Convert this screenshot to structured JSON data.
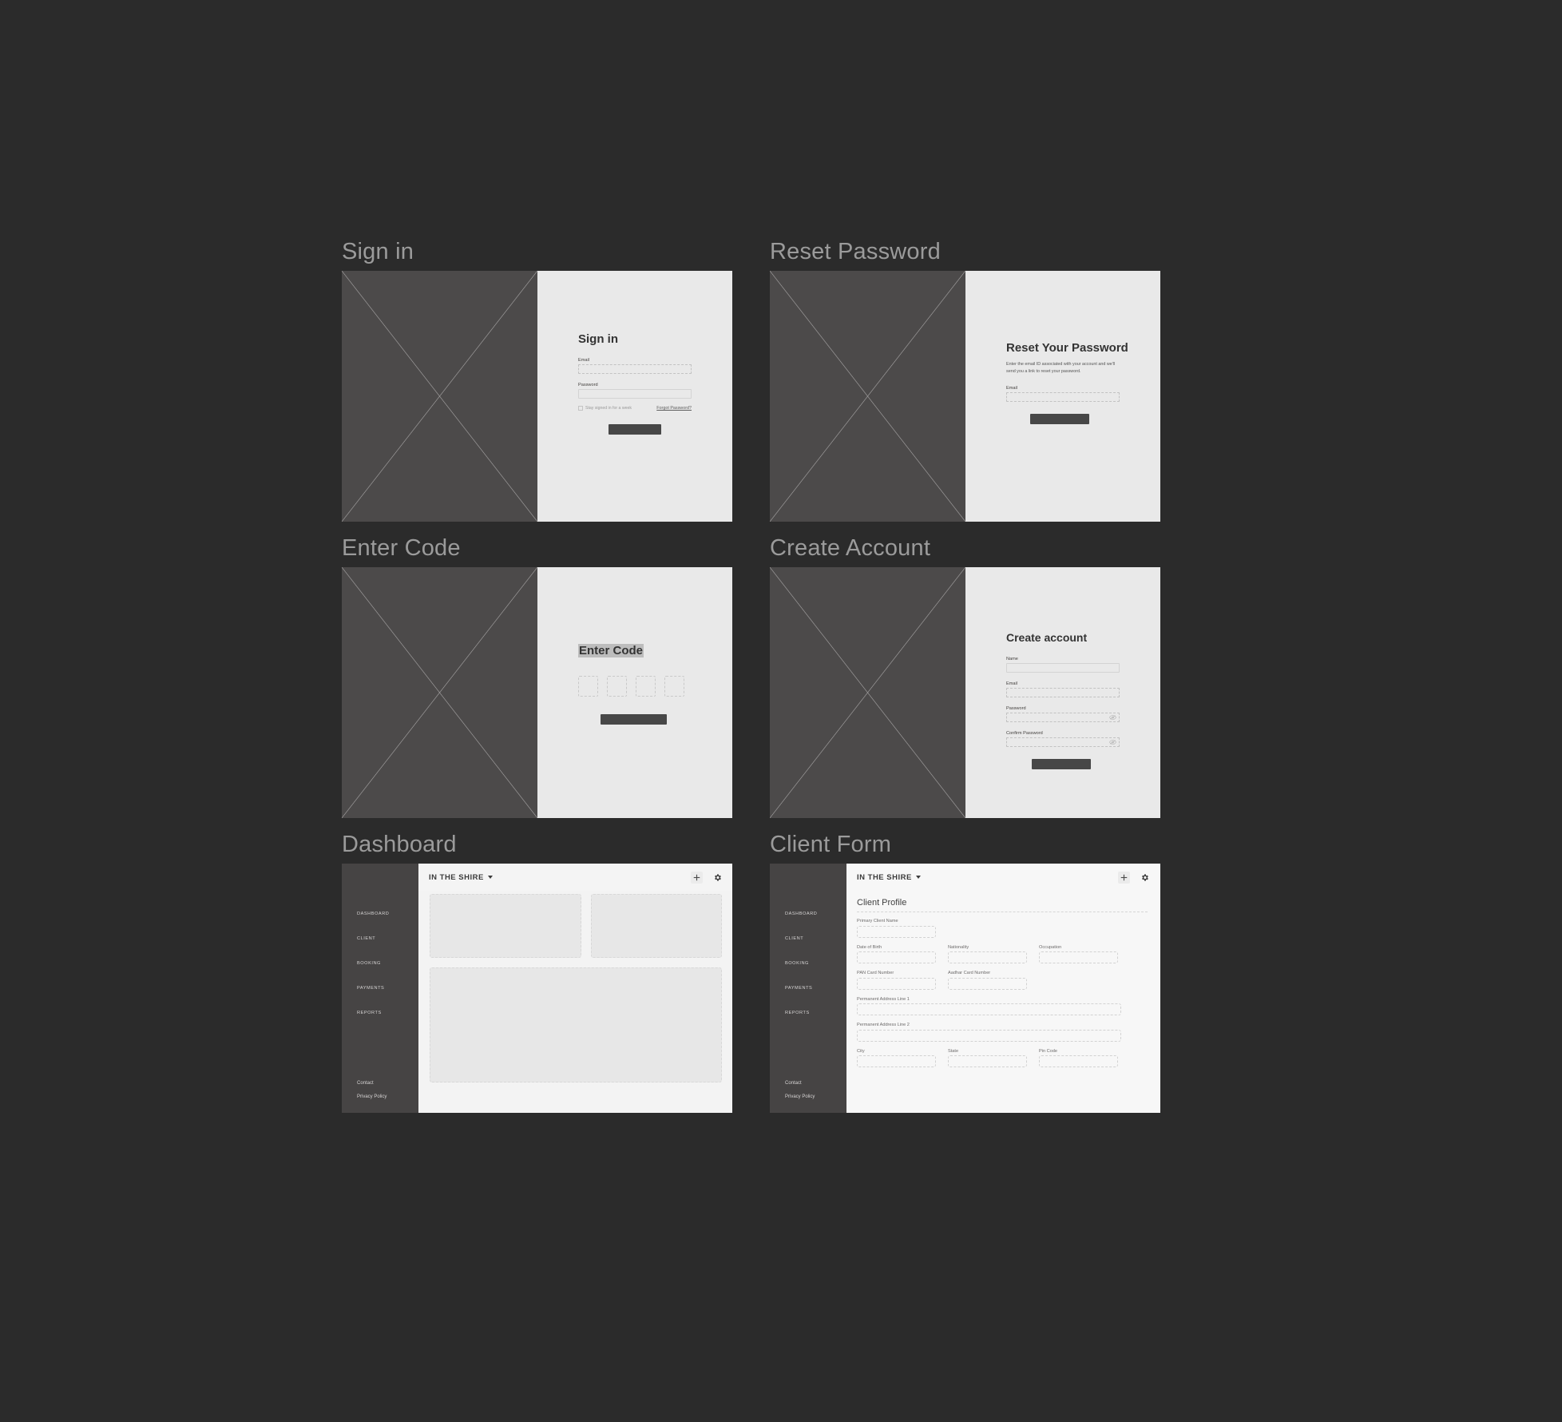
{
  "canvas": {
    "background": "#2b2b2b"
  },
  "frames": [
    {
      "title": "Sign in"
    },
    {
      "title": "Reset Password"
    },
    {
      "title": "Enter Code"
    },
    {
      "title": "Create Account"
    },
    {
      "title": "Dashboard"
    },
    {
      "title": "Client Form"
    }
  ],
  "sign_in": {
    "heading": "Sign in",
    "email_label": "Email",
    "email_value": "",
    "password_label": "Password",
    "password_value": "",
    "stay_signed_in_label": "Stay signed in for a week",
    "forgot_password_link": "Forgot Password?",
    "submit_label": ""
  },
  "reset_password": {
    "heading": "Reset Your Password",
    "description": "Enter the email ID associated with your account and we'll send you a link to reset your password.",
    "email_label": "Email",
    "email_value": "",
    "submit_label": ""
  },
  "enter_code": {
    "heading": "Enter Code",
    "digits": [
      "",
      "",
      "",
      ""
    ],
    "submit_label": ""
  },
  "create_account": {
    "heading": "Create account",
    "name_label": "Name",
    "name_value": "",
    "email_label": "Email",
    "email_value": "",
    "password_label": "Password",
    "password_value": "",
    "confirm_password_label": "Confirm Password",
    "confirm_password_value": "",
    "submit_label": ""
  },
  "app": {
    "brand": "IN THE SHIRE",
    "sidebar": {
      "items": [
        {
          "label": "DASHBOARD"
        },
        {
          "label": "CLIENT"
        },
        {
          "label": "BOOKING"
        },
        {
          "label": "PAYMENTS"
        },
        {
          "label": "REPORTS"
        }
      ],
      "footer": [
        {
          "label": "Contact"
        },
        {
          "label": "Privacy Policy"
        }
      ]
    },
    "header_icons": [
      {
        "name": "plus-icon"
      },
      {
        "name": "gear-icon"
      }
    ]
  },
  "dashboard": {
    "cards": [
      {
        "label": ""
      },
      {
        "label": ""
      },
      {
        "label": ""
      }
    ]
  },
  "client_form": {
    "title": "Client Profile",
    "fields": {
      "primary_client_name": {
        "label": "Primary Client Name",
        "value": ""
      },
      "date_of_birth": {
        "label": "Date of Birth",
        "value": ""
      },
      "nationality": {
        "label": "Nationality",
        "value": ""
      },
      "occupation": {
        "label": "Occupation",
        "value": ""
      },
      "pan_card_number": {
        "label": "PAN Card Number",
        "value": ""
      },
      "aadhar_card_number": {
        "label": "Aadhar Card Number",
        "value": ""
      },
      "permanent_address_line_1": {
        "label": "Permanent Address Line 1",
        "value": ""
      },
      "permanent_address_line_2": {
        "label": "Permanent Address Line 2",
        "value": ""
      },
      "city": {
        "label": "City",
        "value": ""
      },
      "state": {
        "label": "State",
        "value": ""
      },
      "pin_code": {
        "label": "Pin Code",
        "value": ""
      }
    }
  },
  "colors": {
    "canvas_bg": "#2b2b2b",
    "frame_title": "#9b9b9b",
    "image_placeholder": "#4c4a4a",
    "form_bg": "#e9e9e9",
    "sidebar_bg": "#464444",
    "app_bg": "#f3f3f3",
    "button_fill": "#474747",
    "card_fill": "#e7e7e7"
  }
}
